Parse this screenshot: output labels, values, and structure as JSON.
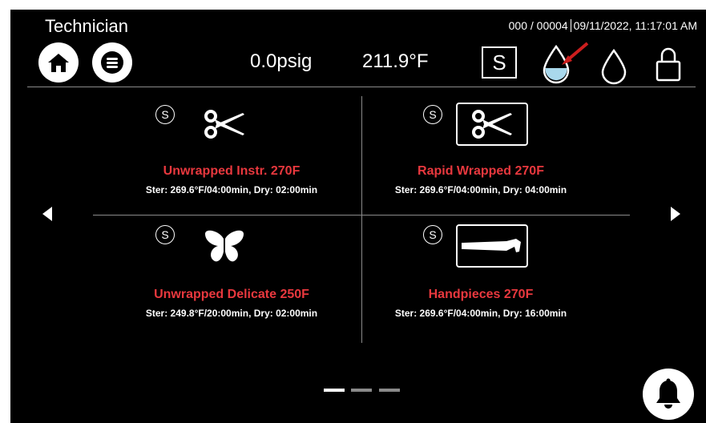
{
  "header": {
    "role": "Technician",
    "cycle_counter": "000 / 00004",
    "datetime": "09/11/2022, 11:17:01 AM",
    "pressure": "0.0psig",
    "temperature": "211.9°F",
    "s_button": "S"
  },
  "programs": [
    {
      "badge": "S",
      "name": "Unwrapped Instr. 270F",
      "params": "Ster: 269.6°F/04:00min, Dry: 02:00min",
      "icon": "scissors-icon"
    },
    {
      "badge": "S",
      "name": "Rapid Wrapped 270F",
      "params": "Ster: 269.6°F/04:00min, Dry: 04:00min",
      "icon": "wrapped-scissors-icon"
    },
    {
      "badge": "S",
      "name": "Unwrapped Delicate 250F",
      "params": "Ster: 249.8°F/20:00min, Dry: 02:00min",
      "icon": "butterfly-icon"
    },
    {
      "badge": "S",
      "name": "Handpieces 270F",
      "params": "Ster: 269.6°F/04:00min, Dry: 16:00min",
      "icon": "handpiece-icon"
    }
  ],
  "pagination": {
    "pages": 3,
    "current": 1
  },
  "colors": {
    "program_name": "#e8383e",
    "background": "#000000",
    "water_fill": "#a9d8ec",
    "arrow_red": "#cc1e1e"
  }
}
